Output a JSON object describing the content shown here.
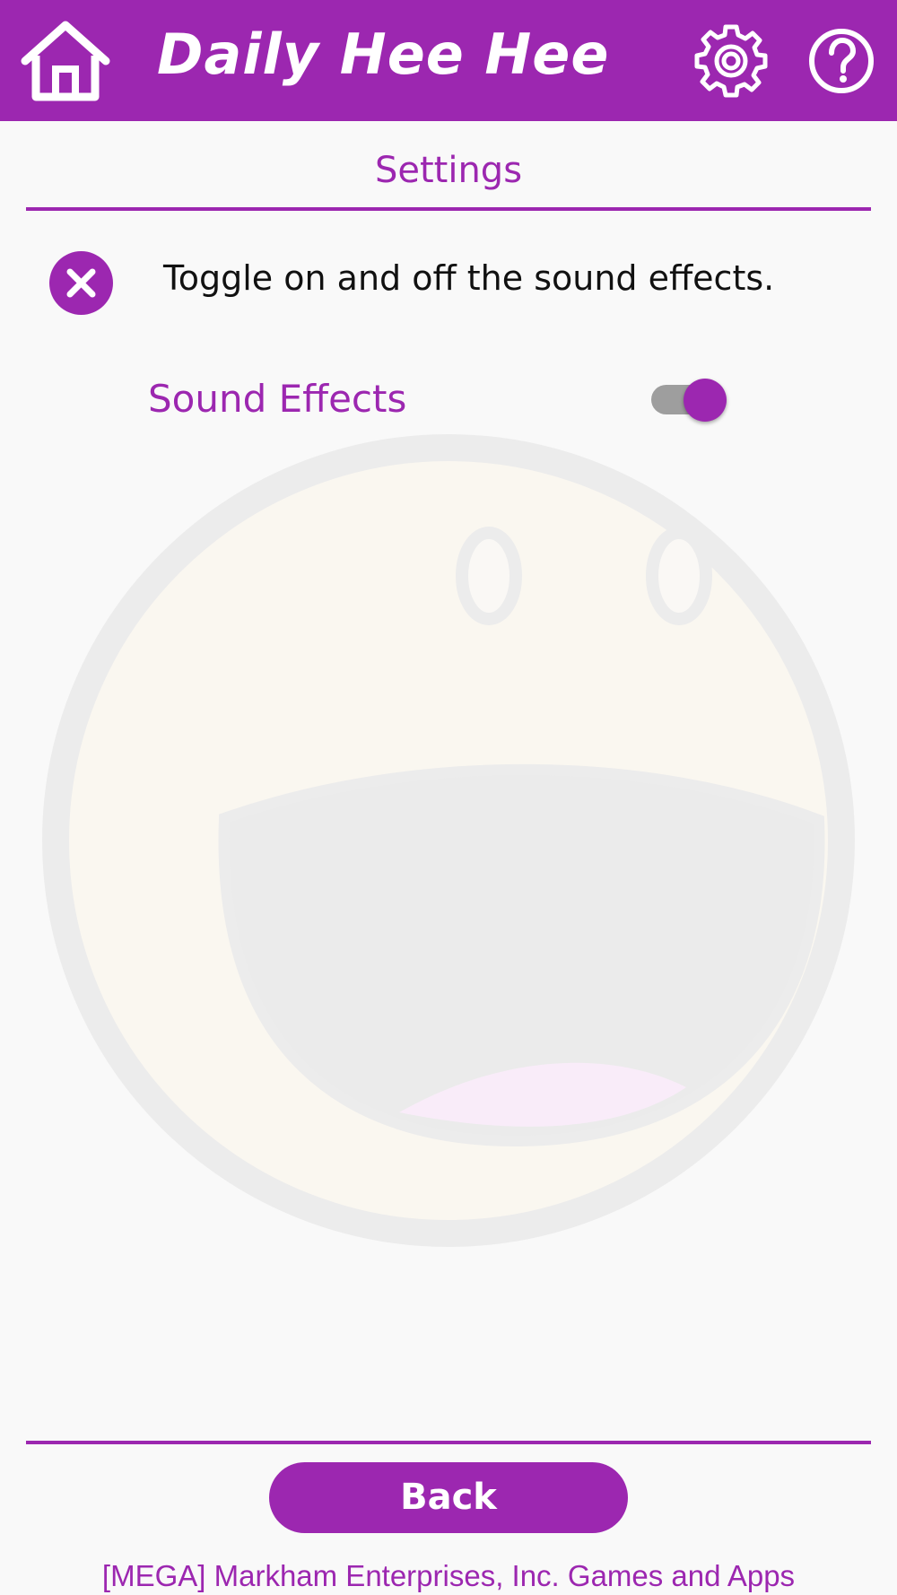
{
  "header": {
    "title": "Daily Hee Hee",
    "home_icon": "home-icon",
    "settings_icon": "gear-icon",
    "help_icon": "help-icon"
  },
  "settings": {
    "title": "Settings",
    "hint": "Toggle on and off the sound effects.",
    "close_icon": "close-icon",
    "sound_effects_label": "Sound Effects",
    "sound_effects_enabled": true
  },
  "back_button_label": "Back",
  "footer_text": "[MEGA] Markham Enterprises, Inc. Games and Apps",
  "colors": {
    "accent": "#9c27b0",
    "background": "#f9f9f9",
    "toggle_track": "#9e9e9e"
  }
}
